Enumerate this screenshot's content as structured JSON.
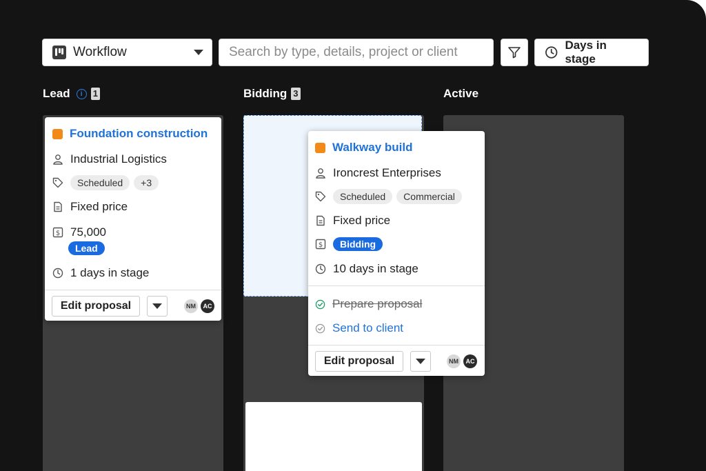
{
  "toolbar": {
    "view_label": "Workflow",
    "search_placeholder": "Search by type, details, project or client",
    "days_label": "Days in stage"
  },
  "columns": [
    {
      "name": "Lead",
      "count": "1"
    },
    {
      "name": "Bidding",
      "count": "3"
    },
    {
      "name": "Active"
    }
  ],
  "lead_card": {
    "title": "Foundation construction",
    "client": "Industrial Logistics",
    "tags": [
      "Scheduled",
      "+3"
    ],
    "pricing": "Fixed price",
    "amount": "75,000",
    "stage_badge": "Lead",
    "days": "1 days in stage",
    "action": "Edit proposal",
    "avatars": [
      "NM",
      "AC"
    ]
  },
  "bidding_card": {
    "title": "Walkway build",
    "client": "Ironcrest Enterprises",
    "tags": [
      "Scheduled",
      "Commercial"
    ],
    "pricing": "Fixed price",
    "stage_badge": "Bidding",
    "days": "10 days in stage",
    "tasks": [
      {
        "label": "Prepare proposal",
        "done": true
      },
      {
        "label": "Send to client",
        "done": false
      }
    ],
    "action": "Edit proposal",
    "avatars": [
      "NM",
      "AC"
    ]
  },
  "colors": {
    "accent": "#1a6ae0",
    "link": "#1f72d8",
    "project_marker": "#f28a1a",
    "background": "#141414",
    "lane": "#3e3e3e"
  }
}
